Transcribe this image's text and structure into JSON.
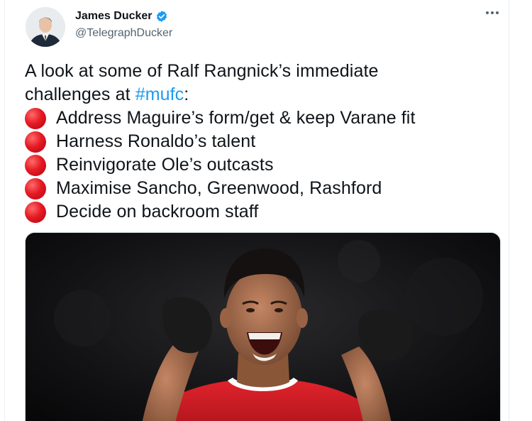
{
  "tweet": {
    "author_name": "James Ducker",
    "author_handle": "@TelegraphDucker",
    "verified_icon": "verified-badge-icon",
    "more_icon": "more-options-icon",
    "text_line1": "A look at some of Ralf Rangnick’s immediate",
    "text_line2_prefix": "challenges at ",
    "hashtag": "#mufc",
    "text_line2_suffix": ":",
    "bullets": [
      "Address Maguire’s form/get & keep Varane fit",
      "Harness Ronaldo’s talent",
      "Reinvigorate Ole’s outcasts",
      "Maximise Sancho, Greenwood, Rashford",
      "Decide on backroom staff"
    ],
    "bullet_icon": "red-circle-emoji",
    "media_description_icon": "tweet-photo"
  },
  "colors": {
    "link": "#1d9bf0",
    "verified": "#1d9bf0",
    "bullet_red": "#e51b24",
    "secondary_text": "#536471"
  }
}
